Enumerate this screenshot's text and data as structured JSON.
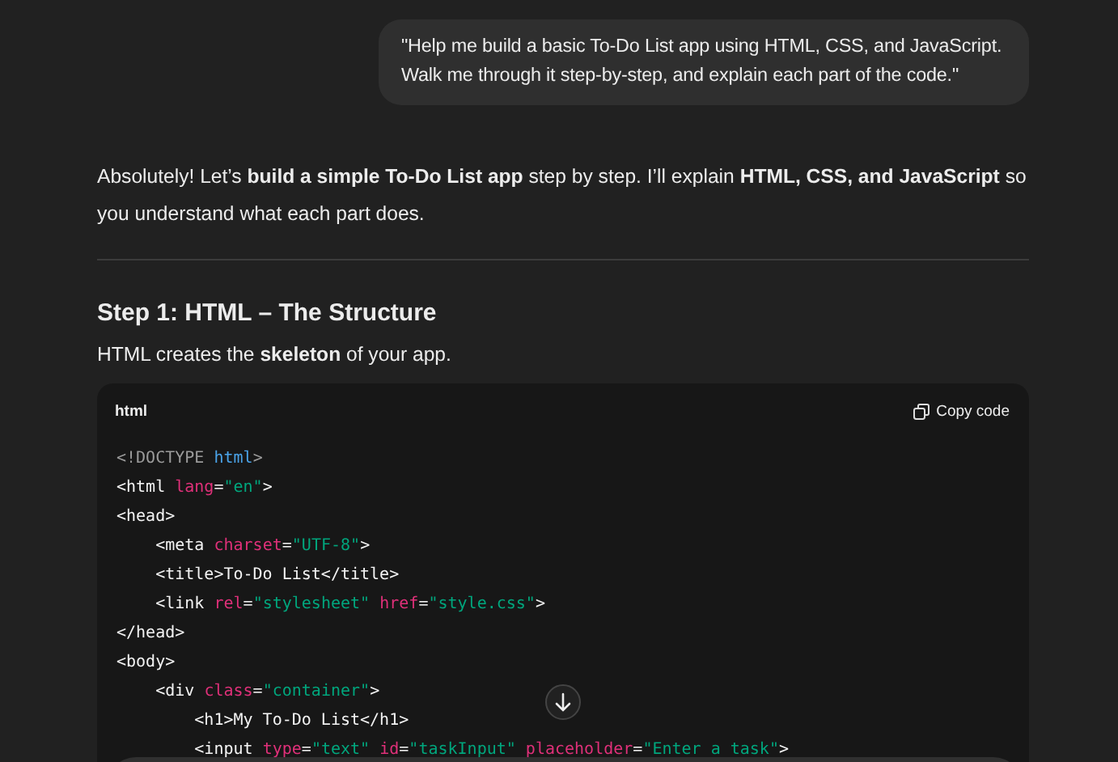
{
  "user_message": "\"Help me build a basic To-Do List app using HTML, CSS, and JavaScript. Walk me through it step-by-step, and explain each part of the code.\"",
  "intro": "Absolutely! Let’s **build a simple To-Do List app** step by step. I’ll explain **HTML, CSS, and JavaScript** so you understand what each part does.",
  "step_heading": "Step 1: HTML – The Structure",
  "step_text": "HTML creates the **skeleton** of your app.",
  "code_block": {
    "language": "html",
    "copy_label": "Copy code",
    "lines": [
      [
        {
          "kind": "doctype",
          "text": "<!DOCTYPE "
        },
        {
          "kind": "keyword",
          "text": "html"
        },
        {
          "kind": "doctype",
          "text": ">"
        }
      ],
      [
        {
          "kind": "tag",
          "text": "<html "
        },
        {
          "kind": "attr",
          "text": "lang"
        },
        {
          "kind": "tag",
          "text": "="
        },
        {
          "kind": "string",
          "text": "\"en\""
        },
        {
          "kind": "tag",
          "text": ">"
        }
      ],
      [
        {
          "kind": "tag",
          "text": "<head>"
        }
      ],
      [
        {
          "kind": "tag",
          "text": "    <meta "
        },
        {
          "kind": "attr",
          "text": "charset"
        },
        {
          "kind": "tag",
          "text": "="
        },
        {
          "kind": "string",
          "text": "\"UTF-8\""
        },
        {
          "kind": "tag",
          "text": ">"
        }
      ],
      [
        {
          "kind": "tag",
          "text": "    <title>To-Do List</title>"
        }
      ],
      [
        {
          "kind": "tag",
          "text": "    <link "
        },
        {
          "kind": "attr",
          "text": "rel"
        },
        {
          "kind": "tag",
          "text": "="
        },
        {
          "kind": "string",
          "text": "\"stylesheet\" "
        },
        {
          "kind": "attr",
          "text": "href"
        },
        {
          "kind": "tag",
          "text": "="
        },
        {
          "kind": "string",
          "text": "\"style.css\""
        },
        {
          "kind": "tag",
          "text": ">"
        }
      ],
      [
        {
          "kind": "tag",
          "text": "</head>"
        }
      ],
      [
        {
          "kind": "tag",
          "text": "<body>"
        }
      ],
      [
        {
          "kind": "tag",
          "text": "    <div "
        },
        {
          "kind": "attr",
          "text": "class"
        },
        {
          "kind": "tag",
          "text": "="
        },
        {
          "kind": "string",
          "text": "\"container\""
        },
        {
          "kind": "tag",
          "text": ">"
        }
      ],
      [
        {
          "kind": "tag",
          "text": "        <h1>My To-Do List</h1>"
        }
      ],
      [
        {
          "kind": "tag",
          "text": "        <input "
        },
        {
          "kind": "attr",
          "text": "type"
        },
        {
          "kind": "tag",
          "text": "="
        },
        {
          "kind": "string",
          "text": "\"text\" "
        },
        {
          "kind": "attr",
          "text": "id"
        },
        {
          "kind": "tag",
          "text": "="
        },
        {
          "kind": "string",
          "text": "\"taskInput\" "
        },
        {
          "kind": "attr",
          "text": "placeholder"
        },
        {
          "kind": "tag",
          "text": "="
        },
        {
          "kind": "string",
          "text": "\"Enter a task\""
        },
        {
          "kind": "tag",
          "text": ">"
        }
      ]
    ]
  }
}
